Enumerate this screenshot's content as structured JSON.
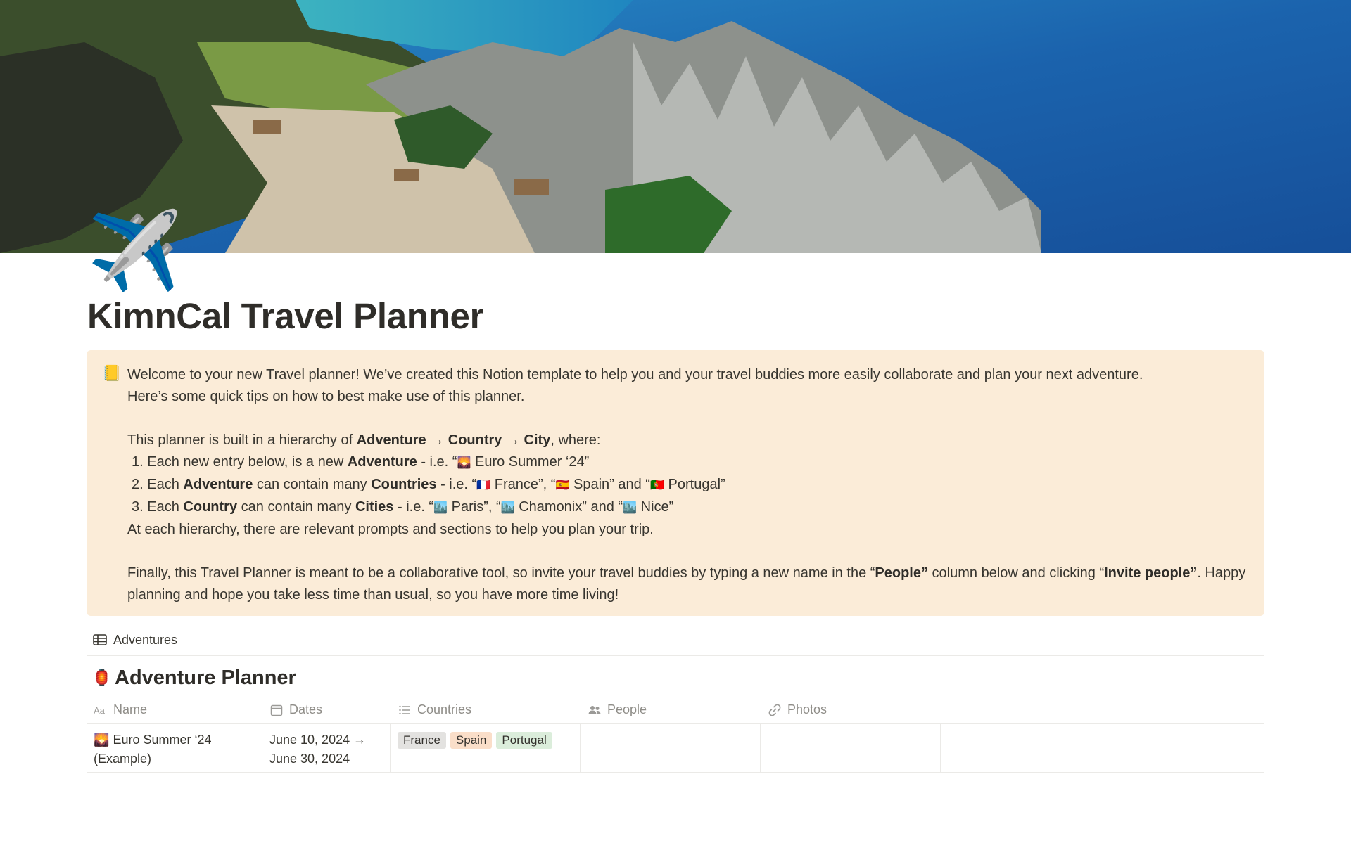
{
  "page": {
    "icon": "airplane-icon",
    "icon_glyph": "✈️",
    "title": "KimnCal Travel Planner"
  },
  "cover": {
    "description": "cover-image"
  },
  "callout": {
    "icon": "notebook-icon",
    "icon_glyph": "📒",
    "background": "#fbecd8",
    "intro_1": "Welcome to your new Travel planner! We’ve created this Notion template to help you and your travel buddies more easily collaborate and plan your next adventure.",
    "intro_2": "Here’s some quick tips on how to best make use of this planner.",
    "hierarchy": {
      "lead": "This planner is built in a hierarchy of ",
      "adventure": "Adventure",
      "arrow1": " → ",
      "country": "Country",
      "arrow2": " → ",
      "city": "City",
      "tail": ", where:"
    },
    "list": [
      {
        "num": "1. ",
        "a": "Each new entry below, is a new ",
        "b": "Adventure",
        "c": " - i.e. “",
        "flag1": "🌄",
        "d": " Euro Summer ‘24”"
      },
      {
        "num": "2. ",
        "a": "Each ",
        "b": "Adventure",
        "c": " can contain many ",
        "d": "Countries",
        "e": " - i.e. “",
        "flag1": "🇫🇷",
        "f": " France”, “",
        "flag2": "🇪🇸",
        "g": " Spain” and “",
        "flag3": "🇵🇹",
        "h": " Portugal”"
      },
      {
        "num": "3. ",
        "a": "Each ",
        "b": "Country",
        "c": " can contain many ",
        "d": "Cities",
        "e": " - i.e. “",
        "flag1": "🏙️",
        "f": " Paris”, “",
        "flag2": "🏙️",
        "g": " Chamonix” and “",
        "flag3": "🏙️",
        "h": " Nice”"
      }
    ],
    "hierarchy_note": "At each hierarchy, there are relevant prompts and sections to help you plan your trip.",
    "finally": {
      "a": "Finally, this Travel Planner is meant to be a collaborative tool, so invite your travel buddies by typing a new name in the “",
      "b": "People”",
      "c": " column below and clicking “",
      "d": "Invite people”",
      "e": ". Happy planning and hope you take less time than usual, so you have more time living!"
    }
  },
  "database": {
    "view_tab": "Adventures",
    "icon_glyph": "🏮",
    "title": "Adventure Planner",
    "columns": [
      {
        "label": "Name",
        "icon": "text-property-icon"
      },
      {
        "label": "Dates",
        "icon": "calendar-icon"
      },
      {
        "label": "Countries",
        "icon": "list-icon"
      },
      {
        "label": "People",
        "icon": "people-icon"
      },
      {
        "label": "Photos",
        "icon": "link-icon"
      }
    ],
    "rows": [
      {
        "name_glyph": "🌄",
        "name_line1": "Euro Summer ‘24",
        "name_line2": "(Example)",
        "dates_line1": "June 10, 2024 →",
        "dates_line2": "June 30, 2024",
        "countries": [
          {
            "label": "France",
            "color": "#e3e2e0"
          },
          {
            "label": "Spain",
            "color": "#fadec9"
          },
          {
            "label": "Portugal",
            "color": "#dbeddb"
          }
        ]
      }
    ]
  }
}
